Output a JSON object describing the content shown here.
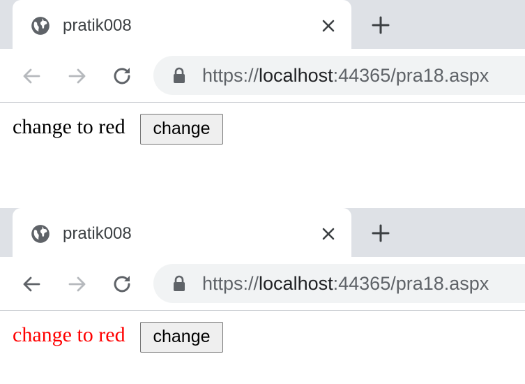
{
  "colors": {
    "tabstrip_bg": "#dee1e6",
    "omnibox_bg": "#f1f3f4",
    "icon_gray": "#5f6368",
    "icon_disabled": "#b6b9bd",
    "red_text": "#ff0000"
  },
  "screenshots": [
    {
      "tab": {
        "title": "pratik008",
        "favicon": "globe-icon",
        "close_icon": "close-icon"
      },
      "new_tab_icon": "plus-icon",
      "nav": {
        "back": "back-arrow-icon",
        "back_enabled": false,
        "forward": "forward-arrow-icon",
        "forward_enabled": false,
        "reload": "reload-icon"
      },
      "address": {
        "lock_icon": "lock-icon",
        "scheme": "https://",
        "host": "localhost",
        "rest": ":44365/pra18.aspx"
      },
      "page": {
        "label": "change to red",
        "label_color": "#000000",
        "button_label": "change"
      }
    },
    {
      "tab": {
        "title": "pratik008",
        "favicon": "globe-icon",
        "close_icon": "close-icon"
      },
      "new_tab_icon": "plus-icon",
      "nav": {
        "back": "back-arrow-icon",
        "back_enabled": true,
        "forward": "forward-arrow-icon",
        "forward_enabled": false,
        "reload": "reload-icon"
      },
      "address": {
        "lock_icon": "lock-icon",
        "scheme": "https://",
        "host": "localhost",
        "rest": ":44365/pra18.aspx"
      },
      "page": {
        "label": "change to red",
        "label_color": "#ff0000",
        "button_label": "change"
      }
    }
  ]
}
